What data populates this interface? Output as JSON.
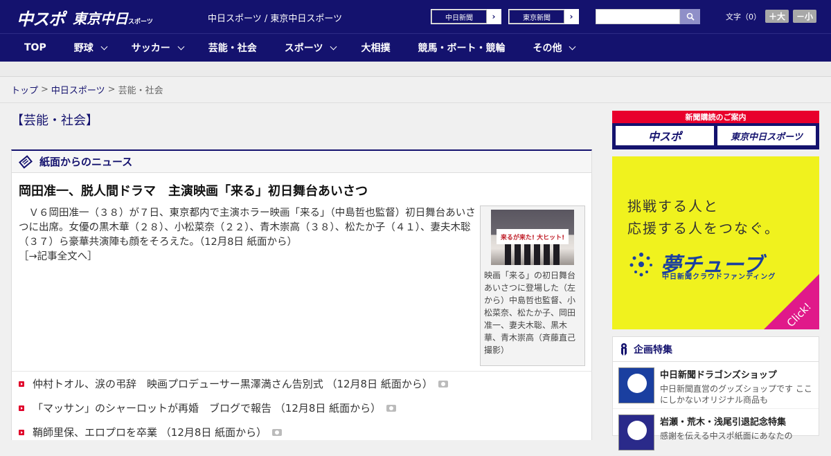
{
  "header": {
    "logo_main": "中スポ",
    "logo_tokyo": "東京中日",
    "logo_tokyo_sub": "スポーツ",
    "site_links": "中日スポーツ / 東京中日スポーツ",
    "paper_buttons": [
      "中日新聞",
      "東京新聞"
    ],
    "search": {
      "placeholder": "",
      "value": ""
    },
    "font_label": "文字（0）",
    "font_bigger": "＋大",
    "font_smaller": "－小"
  },
  "nav": {
    "items": [
      {
        "label": "TOP",
        "dropdown": false
      },
      {
        "label": "野球",
        "dropdown": true
      },
      {
        "label": "サッカー",
        "dropdown": true
      },
      {
        "label": "芸能・社会",
        "dropdown": false
      },
      {
        "label": "スポーツ",
        "dropdown": true
      },
      {
        "label": "大相撲",
        "dropdown": false
      },
      {
        "label": "競馬・ボート・競輪",
        "dropdown": false
      },
      {
        "label": "その他",
        "dropdown": true
      }
    ]
  },
  "breadcrumb": {
    "items": [
      "トップ",
      "中日スポーツ",
      "芸能・社会"
    ],
    "separator": ">"
  },
  "main": {
    "category_title": "【芸能・社会】",
    "section_title": "紙面からのニュース",
    "headline": "岡田准一、脱人間ドラマ　主演映画「来る」初日舞台あいさつ",
    "lead": "Ｖ６岡田准一（３８）が７日、東京都内で主演ホラー映画「来る」（中島哲也監督）初日舞台あいさつに出席。女優の黒木華（２８）、小松菜奈（２２）、青木崇高（３８）、松たか子（４１）、妻夫木聡（３７）ら豪華共演陣も顔をそろえた。（12月8日 紙面から）",
    "more_link": "［→記事全文へ］",
    "photo_banner": "来るが来た! 大ヒット!",
    "photo_caption": "映画「来る」の初日舞台あいさつに登場した（左から）中島哲也監督、小松菜奈、松たか子、岡田准一、妻夫木聡、黒木華、青木崇高（斉藤直己撮影）",
    "news_list": [
      "仲村トオル、涙の弔辞　映画プロデューサー黒澤満さん告別式 （12月8日 紙面から）",
      "「マッサン」のシャーロットが再婚　ブログで報告 （12月8日 紙面から）",
      "鞘師里保、エロプロを卒業 （12月8日 紙面から）"
    ]
  },
  "sidebar": {
    "subscribe_banner": "新聞購読のご案内",
    "subscribe_buttons": [
      "中スポ",
      "東京中日スポーツ"
    ],
    "ad_line1": "挑戦する人と",
    "ad_line2": "応援する人をつなぐ。",
    "ad_brand": "夢チューブ",
    "ad_sub": "中日新聞クラウドファンディング",
    "ad_click": "Click!",
    "feature_title": "企画特集",
    "features": [
      {
        "title": "中日新聞ドラゴンズショップ",
        "desc": "中日新聞直営のグッズショップです ここにしかないオリジナル商品も"
      },
      {
        "title": "岩瀬・荒木・浅尾引退記念特集",
        "desc": "感謝を伝える中スポ紙面にあなたの"
      }
    ]
  }
}
